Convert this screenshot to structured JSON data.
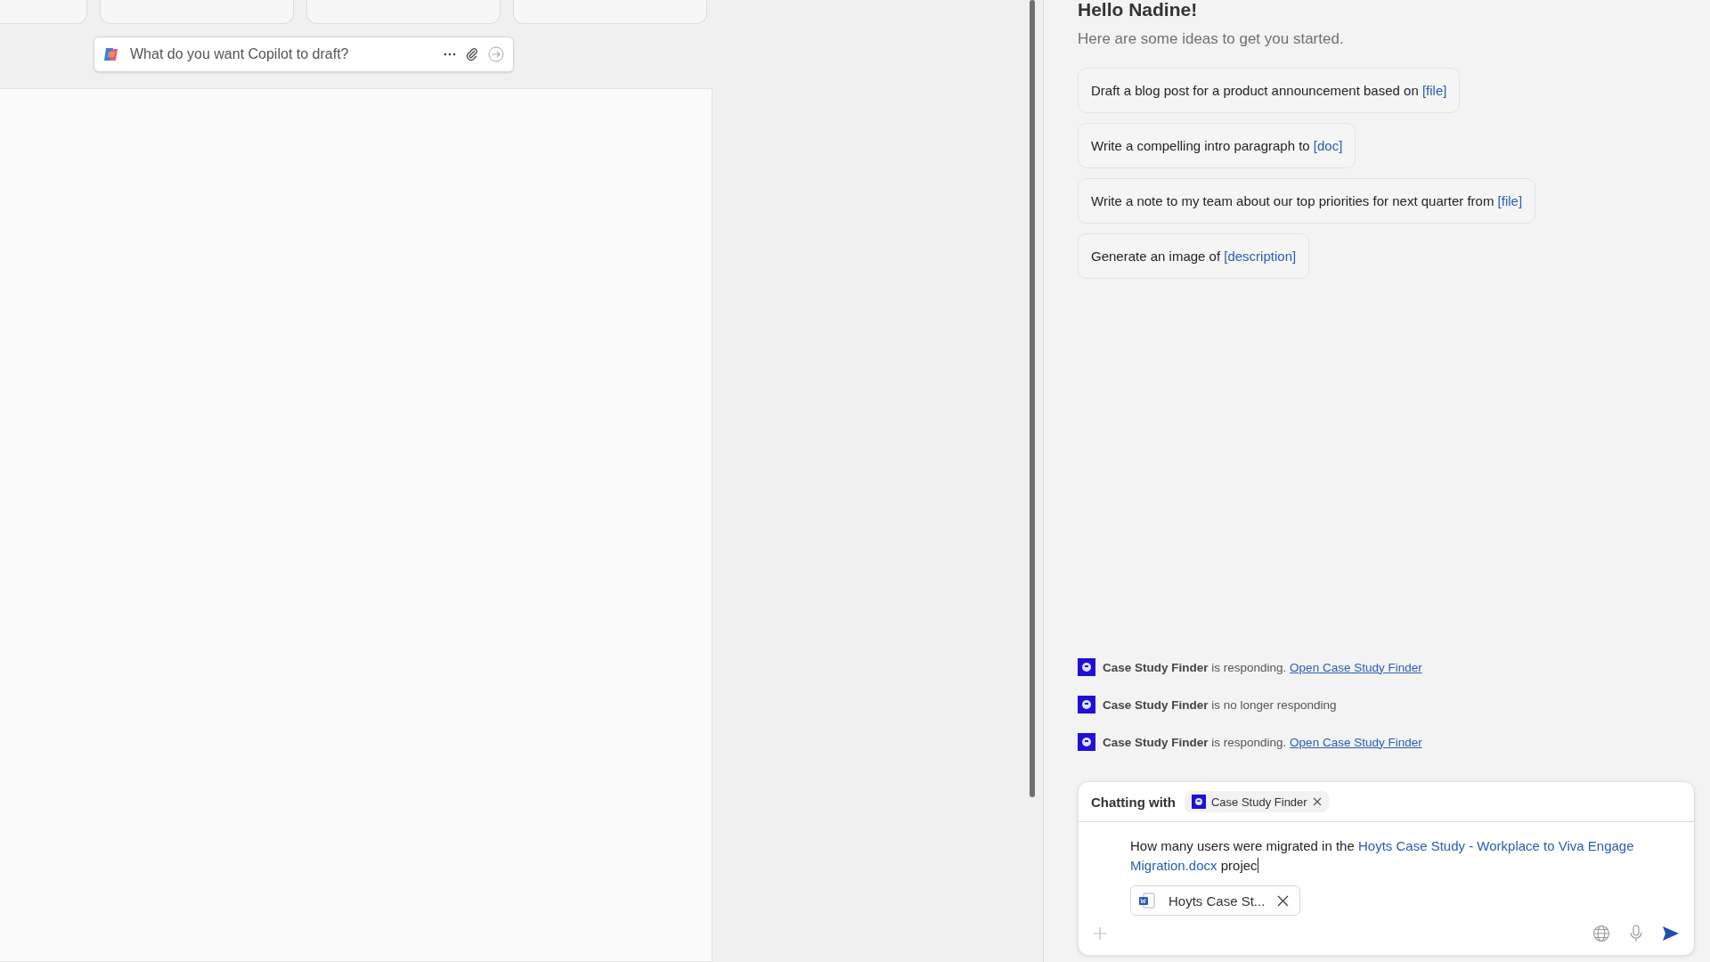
{
  "draft_prompt": {
    "placeholder": "What do you want Copilot to draft?"
  },
  "greeting": {
    "title": "Hello Nadine!",
    "subtitle": "Here are some ideas to get you started."
  },
  "suggestions": [
    {
      "text": "Draft a blog post for a product announcement based on",
      "token": "[file]"
    },
    {
      "text": "Write a compelling intro paragraph to",
      "token": "[doc]"
    },
    {
      "text": "Write a note to my team about our top priorities for next quarter from",
      "token": "[file]"
    },
    {
      "text": "Generate an image of",
      "token": "[description]"
    }
  ],
  "status_messages": [
    {
      "text": "**Case Study Finder** is responding.",
      "link": "Open Case Study Finder"
    },
    {
      "text": "**Case Study Finder** is no longer responding"
    },
    {
      "text": "**Case Study Finder** is responding.",
      "link": "Open Case Study Finder"
    }
  ],
  "composer": {
    "chatting_label": "Chatting with",
    "agent": "Case Study Finder",
    "message": [
      {
        "kind": "text",
        "text": "How many users were migrated in the"
      },
      {
        "kind": "link",
        "text": "Hoyts Case Study - Workplace to Viva Engage Migration.docx"
      },
      {
        "kind": "text",
        "text": "projec"
      }
    ],
    "attachment": "Hoyts Case St..."
  }
}
